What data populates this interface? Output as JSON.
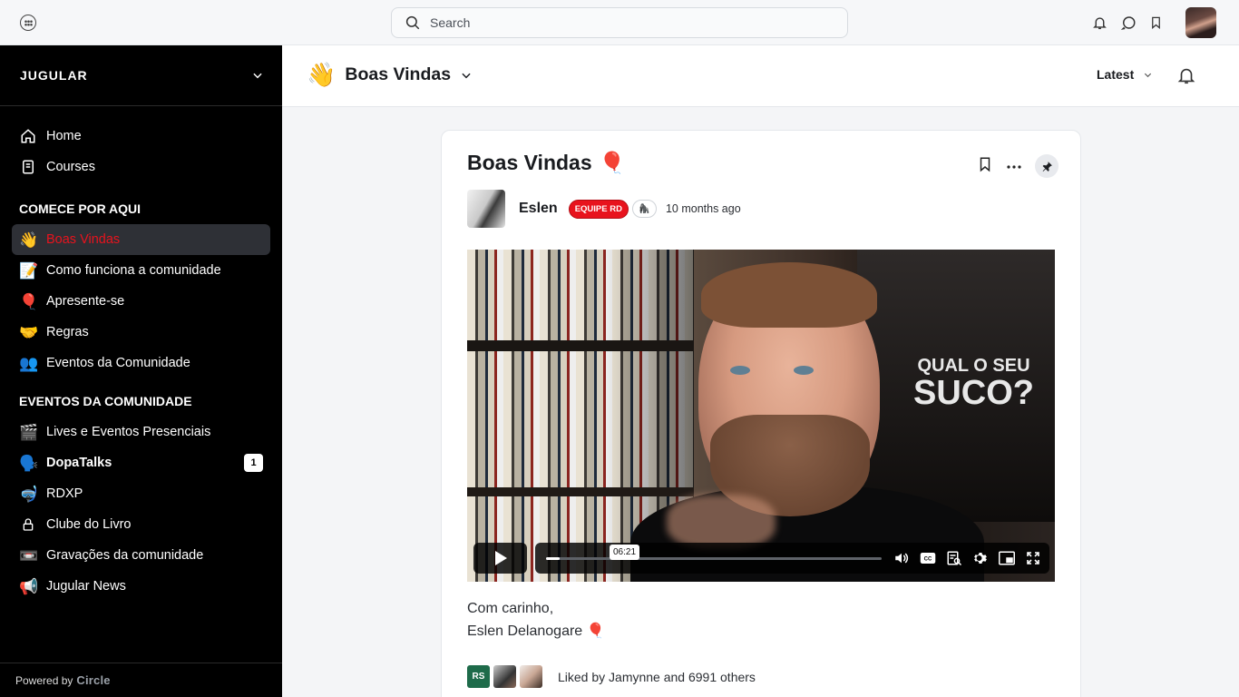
{
  "topbar": {
    "search_placeholder": "Search"
  },
  "sidebar": {
    "brand": "JUGULAR",
    "top_items": [
      {
        "label": "Home",
        "icon": "home-icon"
      },
      {
        "label": "Courses",
        "icon": "courses-icon"
      }
    ],
    "sections": [
      {
        "title": "COMECE POR AQUI",
        "items": [
          {
            "emoji": "👋",
            "label": "Boas Vindas",
            "active": true
          },
          {
            "emoji": "📝",
            "label": "Como funciona a comunidade"
          },
          {
            "emoji": "🎈",
            "label": "Apresente-se"
          },
          {
            "emoji": "🤝",
            "label": "Regras"
          },
          {
            "emoji": "👥",
            "label": "Eventos da Comunidade"
          }
        ]
      },
      {
        "title": "EVENTOS DA COMUNIDADE",
        "items": [
          {
            "emoji": "🎬",
            "label": "Lives e Eventos Presenciais"
          },
          {
            "emoji": "🗣️",
            "label": "DopaTalks",
            "bold": true,
            "badge": "1"
          },
          {
            "emoji": "🤿",
            "label": "RDXP"
          },
          {
            "icon": "lock-icon",
            "label": "Clube do Livro"
          },
          {
            "emoji": "📼",
            "label": "Gravações da comunidade"
          },
          {
            "emoji": "📢",
            "label": "Jugular News"
          }
        ]
      }
    ],
    "powered_by": "Powered by",
    "powered_brand": "Circle"
  },
  "space": {
    "emoji": "👋",
    "title": "Boas Vindas",
    "sort_label": "Latest"
  },
  "post": {
    "title": "Boas Vindas",
    "title_emoji": "🎈",
    "author": "Eslen",
    "author_badge": "EQUIPE RD",
    "secondary_badge": "🦍",
    "time": "10 months ago",
    "video": {
      "poster_line1": "QUAL O SEU",
      "poster_line2": "SUCO?",
      "time_tooltip": "06:21",
      "progress": 0.04
    },
    "body_line1": "Com carinho,",
    "body_line2": "Eslen Delanogare",
    "body_emoji": "🎈",
    "likes": {
      "avatar_initials": "RS",
      "text": "Liked by Jamynne and 6991 others"
    }
  }
}
